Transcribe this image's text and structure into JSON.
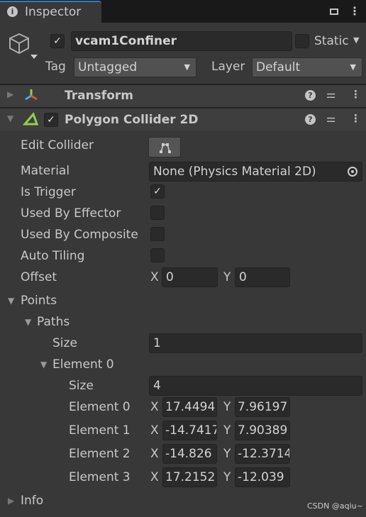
{
  "tab": {
    "title": "Inspector",
    "info_icon": "info-icon",
    "lock_icon": "lock-icon",
    "menu_icon": "kebab-icon"
  },
  "object": {
    "name": "vcam1Confiner",
    "active": true,
    "static_label": "Static",
    "static": false,
    "tag_label": "Tag",
    "tag_value": "Untagged",
    "layer_label": "Layer",
    "layer_value": "Default"
  },
  "components": {
    "transform": {
      "title": "Transform",
      "expanded": false
    },
    "polygon": {
      "title": "Polygon Collider 2D",
      "enabled": true,
      "expanded": true,
      "edit_collider": "Edit Collider",
      "material_label": "Material",
      "material_value": "None (Physics Material 2D)",
      "is_trigger": "Is Trigger",
      "is_trigger_value": true,
      "used_by_effector": "Used By Effector",
      "used_by_effector_value": false,
      "used_by_composite": "Used By Composite",
      "used_by_composite_value": false,
      "auto_tiling": "Auto Tiling",
      "auto_tiling_value": false,
      "offset": "Offset",
      "offset_x": "0",
      "offset_y": "0",
      "points": "Points",
      "paths": "Paths",
      "size_label": "Size",
      "paths_size": "1",
      "element0": "Element 0",
      "element0_size": "4",
      "elements": [
        {
          "label": "Element 0",
          "x": "17.4494",
          "y": "7.96197"
        },
        {
          "label": "Element 1",
          "x": "-14.7417",
          "y": "7.90389"
        },
        {
          "label": "Element 2",
          "x": "-14.826",
          "y": "-12.3714"
        },
        {
          "label": "Element 3",
          "x": "17.2152",
          "y": "-12.039"
        }
      ],
      "info": "Info"
    }
  },
  "axis": {
    "x": "X",
    "y": "Y"
  },
  "watermark": "CSDN @aqiu~"
}
